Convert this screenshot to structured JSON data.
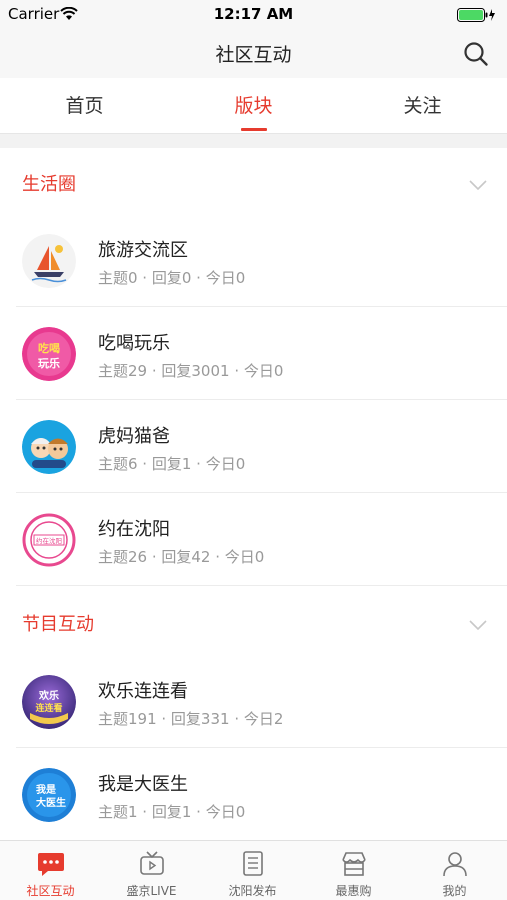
{
  "status_bar": {
    "carrier": "Carrier",
    "time": "12:17 AM"
  },
  "nav": {
    "title": "社区互动"
  },
  "tabs": [
    {
      "label": "首页"
    },
    {
      "label": "版块"
    },
    {
      "label": "关注"
    }
  ],
  "active_tab": 1,
  "accent_color": "#e63b2e",
  "sections": [
    {
      "title": "生活圈",
      "items": [
        {
          "title": "旅游交流区",
          "stats": "主题0 · 回复0 · 今日0",
          "icon": "sailboat-avatar"
        },
        {
          "title": "吃喝玩乐",
          "stats": "主题29 · 回复3001 · 今日0",
          "icon": "food-fun-avatar",
          "avatar_text": "吃喝玩乐"
        },
        {
          "title": "虎妈猫爸",
          "stats": "主题6 · 回复1 · 今日0",
          "icon": "cartoon-parents-avatar"
        },
        {
          "title": "约在沈阳",
          "stats": "主题26 · 回复42 · 今日0",
          "icon": "meet-shenyang-avatar",
          "avatar_text": "约在沈阳"
        }
      ]
    },
    {
      "title": "节目互动",
      "items": [
        {
          "title": "欢乐连连看",
          "stats": "主题191 · 回复331 · 今日2",
          "icon": "tv-show-avatar",
          "avatar_text": "欢乐连连看"
        },
        {
          "title": "我是大医生",
          "stats": "主题1 · 回复1 · 今日0",
          "icon": "doctor-show-avatar",
          "avatar_text": "我是大医生"
        }
      ]
    }
  ],
  "tab_bar": [
    {
      "label": "社区互动",
      "icon": "chat-bubble-icon",
      "active": true
    },
    {
      "label": "盛京LIVE",
      "icon": "tv-icon",
      "active": false
    },
    {
      "label": "沈阳发布",
      "icon": "document-icon",
      "active": false
    },
    {
      "label": "最惠购",
      "icon": "shop-icon",
      "active": false
    },
    {
      "label": "我的",
      "icon": "person-icon",
      "active": false
    }
  ]
}
